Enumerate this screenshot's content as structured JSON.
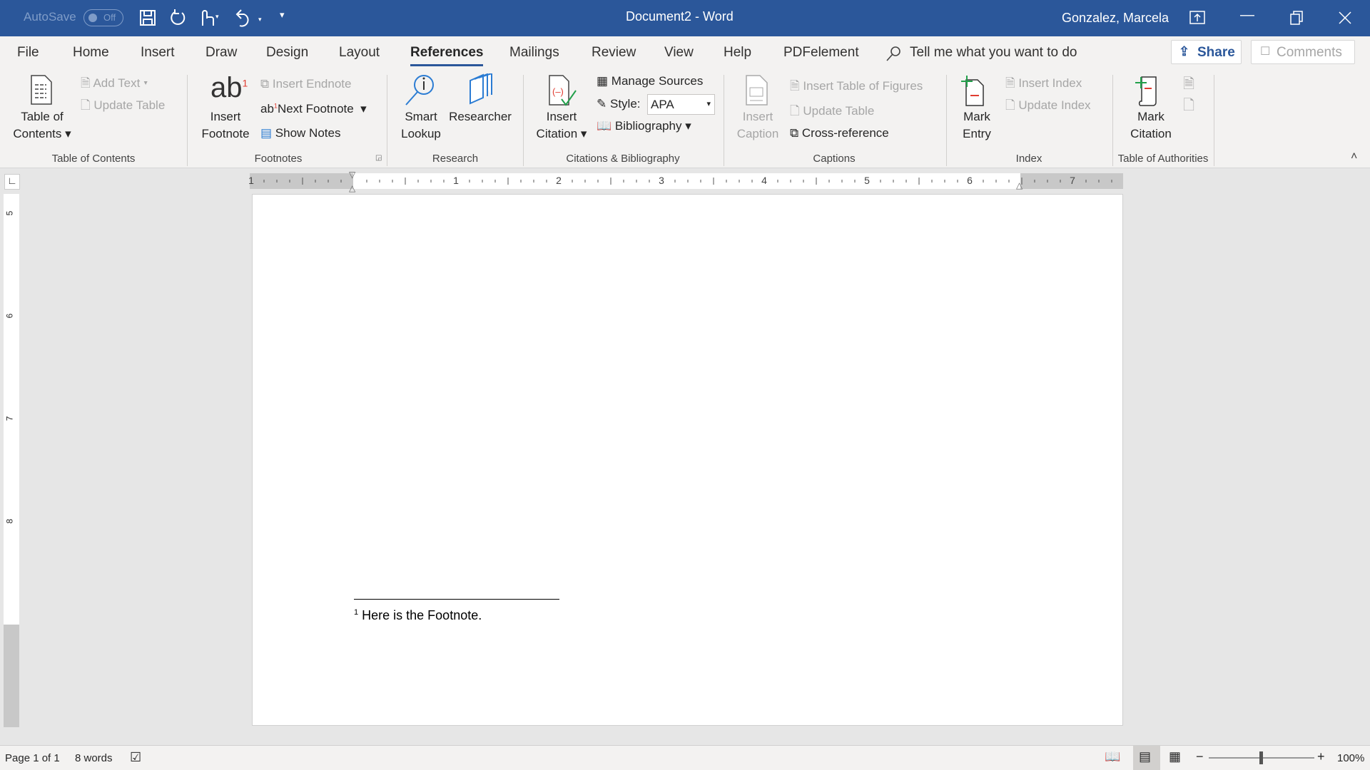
{
  "titlebar": {
    "autosave_label": "AutoSave",
    "autosave_state": "Off",
    "document_title": "Document2  -  Word",
    "user_name": "Gonzalez, Marcela",
    "accent_color": "#2b579a"
  },
  "tabs": [
    {
      "label": "File"
    },
    {
      "label": "Home"
    },
    {
      "label": "Insert"
    },
    {
      "label": "Draw"
    },
    {
      "label": "Design"
    },
    {
      "label": "Layout"
    },
    {
      "label": "References",
      "active": true
    },
    {
      "label": "Mailings"
    },
    {
      "label": "Review"
    },
    {
      "label": "View"
    },
    {
      "label": "Help"
    },
    {
      "label": "PDFelement"
    }
  ],
  "tell_me": "Tell me what you want to do",
  "share_label": "Share",
  "comments_label": "Comments",
  "ribbon": {
    "toc": {
      "big": [
        "Table of",
        "Contents"
      ],
      "add_text": "Add Text",
      "update_table": "Update Table",
      "group": "Table of Contents"
    },
    "footnotes": {
      "big": [
        "Insert",
        "Footnote"
      ],
      "insert_endnote": "Insert Endnote",
      "next_footnote": "Next Footnote",
      "show_notes": "Show Notes",
      "group": "Footnotes"
    },
    "research": {
      "smart_lookup": [
        "Smart",
        "Lookup"
      ],
      "researcher": "Researcher",
      "group": "Research"
    },
    "citations": {
      "big": [
        "Insert",
        "Citation"
      ],
      "manage_sources": "Manage Sources",
      "style_label": "Style:",
      "style_value": "APA",
      "bibliography": "Bibliography",
      "group": "Citations & Bibliography"
    },
    "captions": {
      "big": [
        "Insert",
        "Caption"
      ],
      "insert_tof": "Insert Table of Figures",
      "update_table": "Update Table",
      "cross_reference": "Cross-reference",
      "group": "Captions"
    },
    "index": {
      "big": [
        "Mark",
        "Entry"
      ],
      "insert_index": "Insert Index",
      "update_index": "Update Index",
      "group": "Index"
    },
    "toa": {
      "big": [
        "Mark",
        "Citation"
      ],
      "group": "Table of Authorities"
    }
  },
  "ruler": {
    "numbers": [
      "1",
      "1",
      "2",
      "3",
      "4",
      "5",
      "6",
      "7"
    ],
    "vertical_numbers": [
      "5",
      "6",
      "7",
      "8"
    ]
  },
  "document": {
    "footnote_number": "1",
    "footnote_text": "Here is the Footnote."
  },
  "status": {
    "page": "Page 1 of 1",
    "words": "8 words",
    "zoom": "100%",
    "zoom_percent": 100
  }
}
